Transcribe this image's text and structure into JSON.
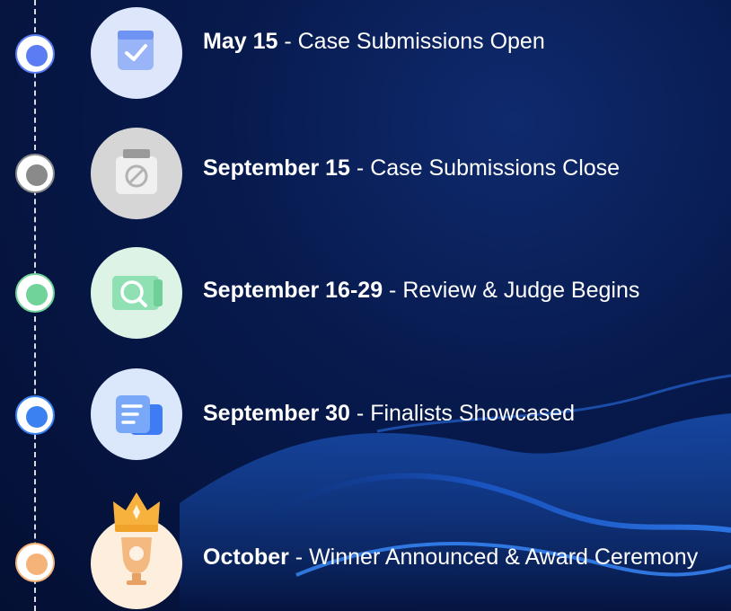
{
  "milestones": [
    {
      "date": "May 15",
      "sep": " - ",
      "desc": "Case Submissions Open",
      "icon": "checkbox-icon",
      "dot_color": "#5b7cf2",
      "badge_bg": "#dde6fb"
    },
    {
      "date": "September 15",
      "sep": " - ",
      "desc": "Case Submissions Close",
      "icon": "closed-box-icon",
      "dot_color": "#8a8a8a",
      "badge_bg": "#d6d6d6"
    },
    {
      "date": "September 16-29",
      "sep": " - ",
      "desc": "Review & Judge Begins",
      "icon": "magnifier-icon",
      "dot_color": "#6fd39a",
      "badge_bg": "#dcf3e6"
    },
    {
      "date": "September 30",
      "sep": " - ",
      "desc": "Finalists Showcased",
      "icon": "document-icon",
      "dot_color": "#3b82f0",
      "badge_bg": "#dbe7fb"
    },
    {
      "date": "October",
      "sep": " - ",
      "desc": "Winner Announced & Award Ceremony",
      "icon": "trophy-crown-icon",
      "dot_color": "#f5b279",
      "badge_bg": "#fdeedd"
    }
  ]
}
